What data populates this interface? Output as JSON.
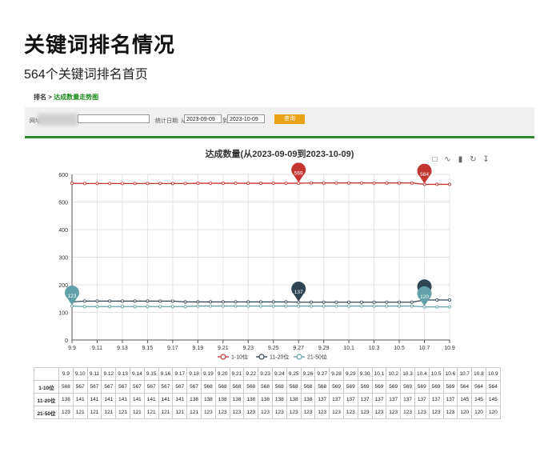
{
  "page": {
    "title": "关键词排名情况",
    "subtitle": "564个关键词排名首页"
  },
  "breadcrumb": {
    "root": "排名",
    "separator": " > ",
    "current": "达成数量走势图"
  },
  "filter": {
    "site_label": "网址",
    "stat_date_label": "统计日期: 从",
    "from_value": "2023-09-09",
    "to_label": "到",
    "to_value": "2023-10-09",
    "query_button": "查询"
  },
  "toolbox_icons": [
    "data-view-icon",
    "line-chart-icon",
    "bar-chart-icon",
    "restore-icon",
    "download-icon"
  ],
  "colors": {
    "series_1_10": "#c23531",
    "series_11_20": "#2f4554",
    "series_21_50": "#61a0a8",
    "accent_green": "#2f8a2f",
    "button": "#e8a317"
  },
  "chart_data": {
    "type": "line",
    "title": "达成数量(从2023-09-09到2023-10-09)",
    "categories": [
      "9.9",
      "9.10",
      "9.11",
      "9.12",
      "9.13",
      "9.14",
      "9.15",
      "9.16",
      "9.17",
      "9.18",
      "9.19",
      "9.20",
      "9.21",
      "9.22",
      "9.23",
      "9.24",
      "9.25",
      "9.26",
      "9.27",
      "9.28",
      "9.29",
      "9.30",
      "10.1",
      "10.2",
      "10.3",
      "10.4",
      "10.5",
      "10.6",
      "10.7",
      "10.8",
      "10.9"
    ],
    "x_tick_labels": [
      "9.9",
      "9.11",
      "9.13",
      "9.15",
      "9.17",
      "9.19",
      "9.21",
      "9.23",
      "9.25",
      "9.27",
      "9.29",
      "10.1",
      "10.3",
      "10.5",
      "10.7",
      "10.9"
    ],
    "ylim": [
      0,
      600
    ],
    "yticks": [
      0,
      100,
      200,
      300,
      400,
      500,
      600
    ],
    "grid": true,
    "legend_position": "bottom",
    "series": [
      {
        "name": "1-10位",
        "values": [
          568,
          567,
          567,
          567,
          567,
          567,
          567,
          567,
          567,
          567,
          568,
          568,
          568,
          568,
          568,
          568,
          568,
          568,
          568,
          569,
          569,
          569,
          569,
          569,
          569,
          569,
          569,
          569,
          564,
          564,
          564
        ],
        "markers": [
          {
            "label": "569",
            "index": 18
          },
          {
            "label": "564",
            "index": 28
          }
        ]
      },
      {
        "name": "11-20位",
        "values": [
          138,
          141,
          141,
          141,
          141,
          141,
          141,
          141,
          141,
          138,
          138,
          138,
          138,
          138,
          138,
          138,
          138,
          138,
          137,
          137,
          137,
          137,
          137,
          137,
          137,
          137,
          137,
          137,
          145,
          145,
          145
        ],
        "markers": [
          {
            "label": "137",
            "index": 18
          },
          {
            "label": "145",
            "index": 28
          }
        ]
      },
      {
        "name": "21-50位",
        "values": [
          123,
          121,
          121,
          121,
          121,
          121,
          121,
          121,
          121,
          121,
          123,
          123,
          123,
          123,
          123,
          123,
          123,
          123,
          123,
          123,
          123,
          123,
          123,
          123,
          123,
          123,
          123,
          123,
          120,
          120,
          120
        ],
        "markers": [
          {
            "label": "123",
            "index": 0
          },
          {
            "label": "120",
            "index": 28
          }
        ]
      }
    ]
  }
}
